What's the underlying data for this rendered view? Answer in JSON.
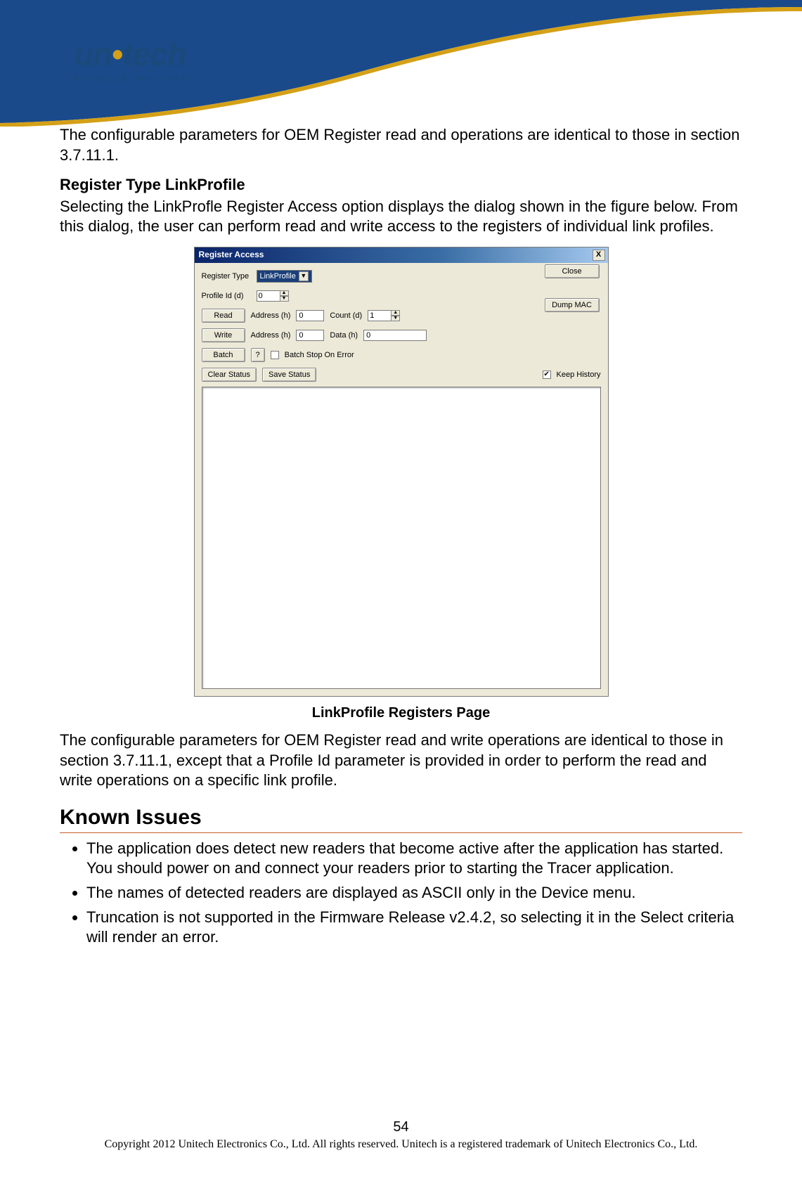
{
  "logo": {
    "word_prefix": "un",
    "word_dot": "i",
    "word_suffix": "tech",
    "tagline": "because we care"
  },
  "paragraph1": "The configurable parameters for OEM Register read and operations are identical to those in section 3.7.11.1.",
  "subheading": "Register Type LinkProfile",
  "paragraph2": "Selecting the LinkProfle Register Access option displays the dialog shown in the figure below. From this dialog, the user can perform read and write access to the registers of individual link profiles.",
  "dialog": {
    "title": "Register Access",
    "close_x": "X",
    "labels": {
      "register_type": "Register Type",
      "profile_id": "Profile Id (d)",
      "address_h": "Address (h)",
      "count_d": "Count (d)",
      "data_h": "Data (h)",
      "batch_stop": "Batch Stop On Error",
      "keep_history": "Keep History"
    },
    "buttons": {
      "close": "Close",
      "read": "Read",
      "write": "Write",
      "batch": "Batch",
      "question": "?",
      "dump_mac": "Dump MAC",
      "clear_status": "Clear Status",
      "save_status": "Save Status"
    },
    "values": {
      "register_type_selected": "LinkProfile",
      "profile_id": "0",
      "read_address": "0",
      "read_count": "1",
      "write_address": "0",
      "write_data": "0",
      "batch_stop_checked": false,
      "keep_history_checked": true
    }
  },
  "caption": "LinkProfile Registers Page",
  "paragraph3": "The configurable parameters for OEM Register read and write operations are identical to those in section 3.7.11.1, except that a Profile Id parameter is provided in order to perform the read and write operations on a specific link profile.",
  "known_issues_heading": "Known Issues",
  "issues": [
    "The application does detect new readers that become active after the application has started. You should power on and connect your readers prior to starting the Tracer application.",
    "The names of detected readers are displayed as ASCII only in the Device menu.",
    "Truncation is not supported in the Firmware Release v2.4.2, so selecting it in the Select criteria will render an error."
  ],
  "footer": {
    "page_number": "54",
    "copyright": "Copyright 2012 Unitech Electronics Co., Ltd. All rights reserved. Unitech is a registered trademark of Unitech Electronics Co., Ltd."
  }
}
